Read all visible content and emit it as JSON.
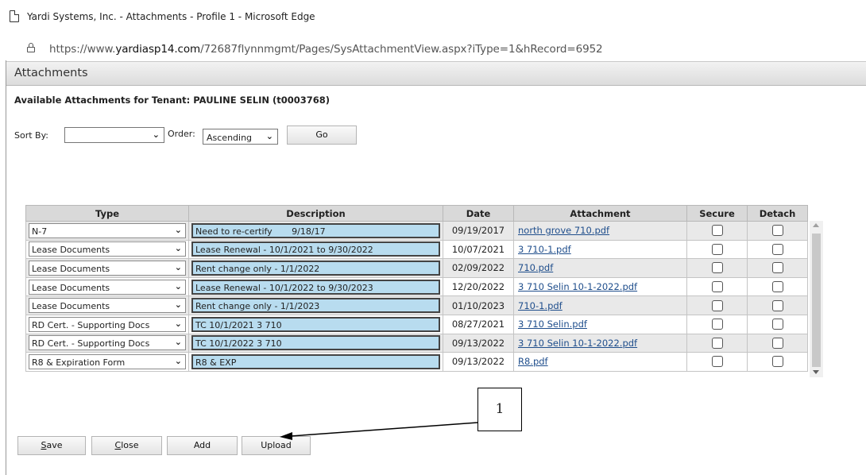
{
  "window": {
    "title": "Yardi Systems, Inc. - Attachments - Profile 1 - Microsoft Edge",
    "url_prefix": "https://www.",
    "url_domain": "yardiasp14.com",
    "url_path": "/72687flynnmgmt/Pages/SysAttachmentView.aspx?iType=1&hRecord=6952"
  },
  "page": {
    "header": "Attachments",
    "subtitle": "Available Attachments for Tenant: PAULINE SELIN (t0003768)"
  },
  "sort": {
    "sort_by_label": "Sort By:",
    "sort_by_value": "",
    "order_label": "Order:",
    "order_value": "Ascending",
    "go_label": "Go"
  },
  "table": {
    "columns": [
      "Type",
      "Description",
      "Date",
      "Attachment",
      "Secure",
      "Detach"
    ],
    "rows": [
      {
        "type": "N-7",
        "description": "Need to re-certify       9/18/17",
        "date": "09/19/2017",
        "attachment": "north grove 710.pdf",
        "secure": false,
        "detach": false
      },
      {
        "type": "Lease Documents",
        "description": "Lease Renewal - 10/1/2021 to 9/30/2022",
        "date": "10/07/2021",
        "attachment": "3 710-1.pdf",
        "secure": false,
        "detach": false
      },
      {
        "type": "Lease Documents",
        "description": "Rent change only - 1/1/2022",
        "date": "02/09/2022",
        "attachment": "710.pdf",
        "secure": false,
        "detach": false
      },
      {
        "type": "Lease Documents",
        "description": "Lease Renewal - 10/1/2022 to 9/30/2023",
        "date": "12/20/2022",
        "attachment": "3 710 Selin 10-1-2022.pdf",
        "secure": false,
        "detach": false
      },
      {
        "type": "Lease Documents",
        "description": "Rent change only - 1/1/2023",
        "date": "01/10/2023",
        "attachment": "710-1.pdf",
        "secure": false,
        "detach": false
      },
      {
        "type": "RD Cert. - Supporting Docs",
        "description": "TC 10/1/2021 3 710",
        "date": "08/27/2021",
        "attachment": "3 710 Selin.pdf",
        "secure": false,
        "detach": false
      },
      {
        "type": "RD Cert. - Supporting Docs",
        "description": "TC 10/1/2022 3 710",
        "date": "09/13/2022",
        "attachment": "3 710 Selin 10-1-2022.pdf",
        "secure": false,
        "detach": false
      },
      {
        "type": "R8 & Expiration Form",
        "description": "R8 & EXP",
        "date": "09/13/2022",
        "attachment": "R8.pdf",
        "secure": false,
        "detach": false
      }
    ]
  },
  "buttons": {
    "save_first": "S",
    "save_rest": "ave",
    "close_first": "C",
    "close_rest": "lose",
    "add": "Add",
    "upload": "Upload"
  },
  "callout": {
    "label": "1"
  },
  "colors": {
    "description_fill": "#b8dcef",
    "link": "#1f4e8c",
    "header_gradient": "#dcdcdc"
  },
  "icons": {
    "tab": "document-icon",
    "security": "lock-icon"
  }
}
